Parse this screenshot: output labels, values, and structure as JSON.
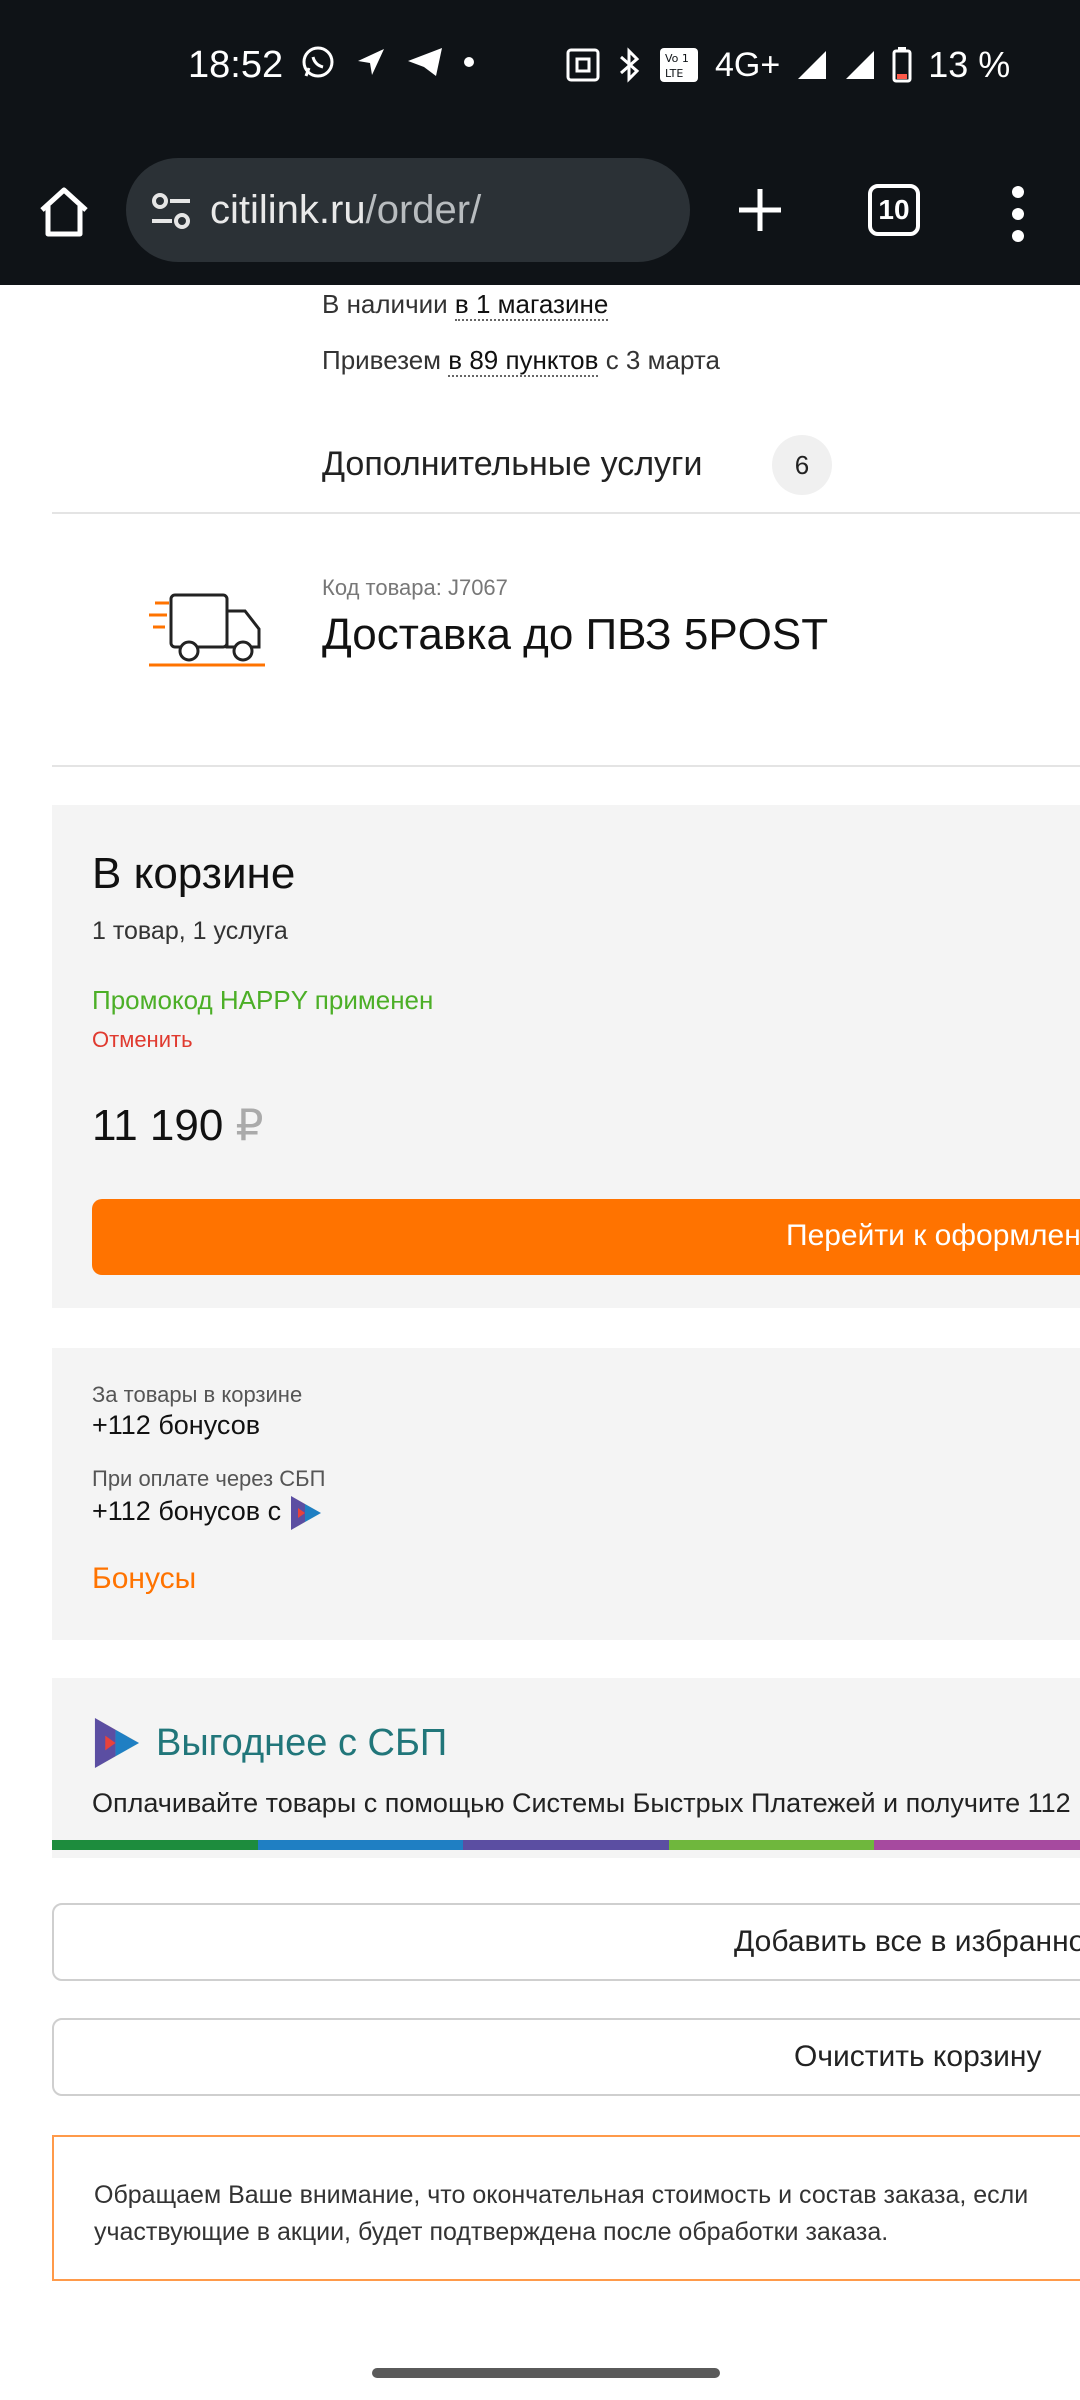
{
  "status_bar": {
    "time": "18:52",
    "network": "4G+",
    "battery_percent": "13 %"
  },
  "browser": {
    "url_domain": "citilink.ru",
    "url_path": "/order/",
    "tab_count": "10"
  },
  "product": {
    "availability_prefix": "В наличии",
    "availability_link": "в 1 магазине",
    "delivery_prefix": "Привезем",
    "delivery_link": "в 89 пунктов",
    "delivery_suffix": "с 3 марта",
    "services_label": "Дополнительные услуги",
    "services_count": "6"
  },
  "service_item": {
    "code_label": "Код товара: J7067",
    "title": "Доставка до ПВЗ 5POST"
  },
  "cart": {
    "title": "В корзине",
    "summary": "1 товар, 1 услуга",
    "promo_text": "Промокод HAPPY применен",
    "cancel_label": "Отменить",
    "price": "11 190",
    "currency": "₽",
    "checkout_label": "Перейти к оформлению"
  },
  "bonuses": {
    "cart_label": "За товары в корзине",
    "cart_value": "+112 бонусов",
    "sbp_label": "При оплате через СБП",
    "sbp_value": "+112 бонусов с",
    "link_label": "Бонусы"
  },
  "sbp_promo": {
    "title": "Выгоднее с СБП",
    "text": "Оплачивайте товары с помощью Системы Быстрых Платежей и получите 112"
  },
  "actions": {
    "add_favorites": "Добавить все в избранное",
    "clear_cart": "Очистить корзину"
  },
  "notice": {
    "line1": "Обращаем Ваше внимание, что окончательная стоимость и состав заказа, если",
    "line2": "участвующие в акции, будет подтверждена после обработки заказа."
  },
  "colors": {
    "accent": "#ff7300",
    "promo_green": "#4caf27",
    "cancel_red": "#e03a2f",
    "sbp_title": "#21767a",
    "sbp_stripe": [
      "#1d8c3d",
      "#1f7fc3",
      "#5b4ea2",
      "#6fb73d",
      "#a64a9f"
    ]
  }
}
